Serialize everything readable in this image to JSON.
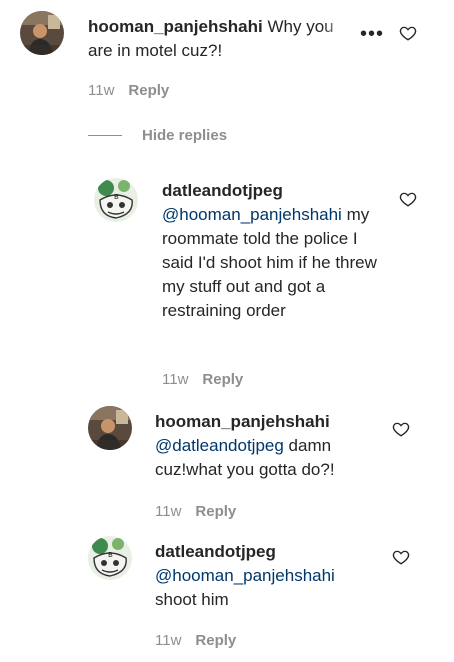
{
  "icons": {
    "like": "heart-outline-icon",
    "more": "more-options-icon"
  },
  "colors": {
    "text": "#262626",
    "secondary": "#8e8e8e",
    "mention": "#00376b"
  },
  "top_comment": {
    "username": "hooman_panjehshahi",
    "text": "Why you are in motel cuz?!",
    "time": "11w",
    "reply_label": "Reply",
    "more_label": "•••"
  },
  "hide_replies_label": "Hide replies",
  "replies": [
    {
      "username": "datleandotjpeg",
      "mention": "@hooman_panjehshahi",
      "text": "my roommate told the police I said I'd shoot him if he threw my stuff out and got a restraining order",
      "time": "11w",
      "reply_label": "Reply"
    },
    {
      "username": "hooman_panjehshahi",
      "mention": "@datleandotjpeg",
      "text": "damn cuz!what you gotta do?!",
      "time": "11w",
      "reply_label": "Reply"
    },
    {
      "username": "datleandotjpeg",
      "mention": "@hooman_panjehshahi",
      "text": "shoot him",
      "time": "11w",
      "reply_label": "Reply"
    }
  ]
}
